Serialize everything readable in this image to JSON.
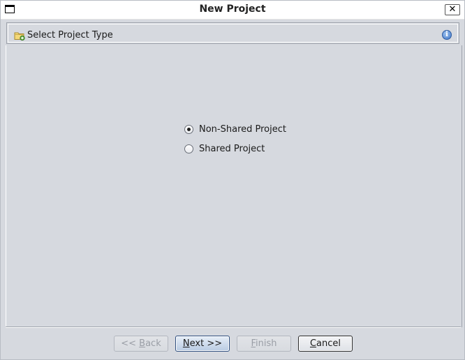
{
  "window": {
    "title": "New Project",
    "close_symbol": "✕"
  },
  "header": {
    "icon": "folder-add-icon",
    "title": "Select Project Type",
    "info_icon": "info-icon",
    "info_glyph": "i"
  },
  "project_type": {
    "options": [
      {
        "label": "Non-Shared Project",
        "selected": true
      },
      {
        "label": "Shared Project",
        "selected": false
      }
    ]
  },
  "buttons": {
    "back": {
      "label": "<< Back",
      "mnemonic": "B",
      "enabled": false
    },
    "next": {
      "label": "Next >>",
      "mnemonic": "N",
      "enabled": true
    },
    "finish": {
      "label": "Finish",
      "mnemonic": "F",
      "enabled": false
    },
    "cancel": {
      "label": "Cancel",
      "mnemonic": "C",
      "enabled": true
    }
  },
  "colors": {
    "background": "#d6d9df",
    "accent": "#3f74c6"
  }
}
